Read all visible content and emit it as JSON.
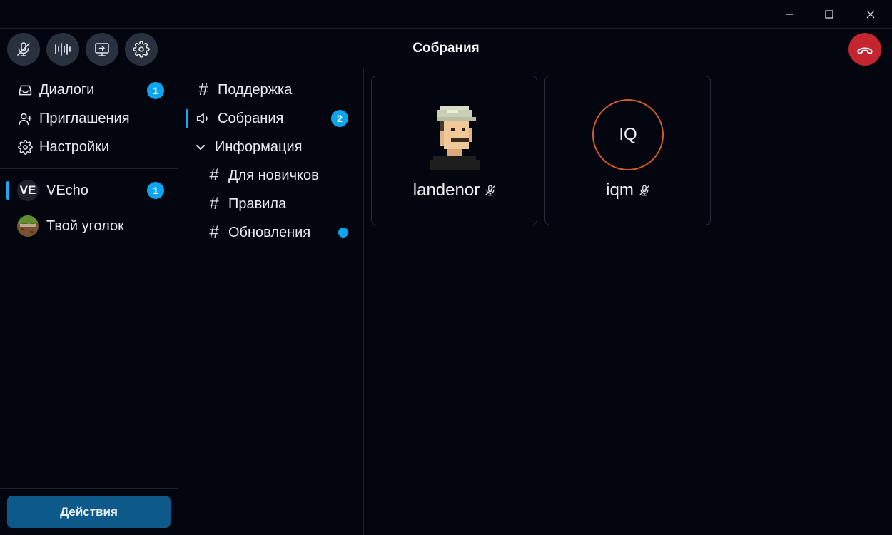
{
  "window": {
    "controls": [
      "minimize-icon",
      "maximize-icon",
      "close-icon"
    ]
  },
  "toolbar": {
    "title": "Собрания",
    "buttons": [
      "mic-off-icon",
      "audio-wave-icon",
      "screen-share-icon",
      "gear-icon"
    ],
    "hangup_icon": "phone-hangup-icon",
    "hangup_color": "#c4262f"
  },
  "sidebar": {
    "nav": [
      {
        "label": "Диалоги",
        "icon": "inbox-icon",
        "badge": "1"
      },
      {
        "label": "Приглашения",
        "icon": "user-plus-icon"
      },
      {
        "label": "Настройки",
        "icon": "gear-icon"
      }
    ],
    "servers": [
      {
        "label": "VEcho",
        "avatar_text": "VE",
        "badge": "1",
        "active": true
      },
      {
        "label": "Твой уголок",
        "icon": "grass-block-icon"
      }
    ],
    "actions_label": "Действия"
  },
  "channels": {
    "items": [
      {
        "label": "Поддержка",
        "icon": "hash-icon"
      },
      {
        "label": "Собрания",
        "icon": "speaker-icon",
        "badge": "2",
        "active": true
      },
      {
        "label": "Информация",
        "icon": "chevron-down-icon"
      },
      {
        "label": "Для новичков",
        "icon": "hash-icon"
      },
      {
        "label": "Правила",
        "icon": "hash-icon"
      },
      {
        "label": "Обновления",
        "icon": "hash-icon",
        "unread_dot": true
      }
    ]
  },
  "participants": [
    {
      "name": "landenor",
      "avatar": "pixel-avatar-icon",
      "muted": true
    },
    {
      "name": "iqm",
      "initials": "IQ",
      "muted": true,
      "ring_color": "#d35a2a"
    }
  ],
  "colors": {
    "accent": "#0ea5f0",
    "background": "#03060f",
    "button": "#2a313e",
    "actions": "#0d5a8a"
  }
}
